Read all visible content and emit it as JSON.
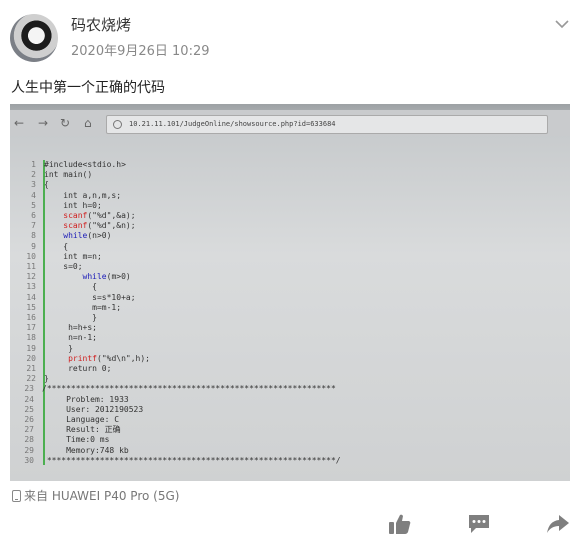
{
  "post": {
    "username": "码农烧烤",
    "timestamp": "2020年9月26日 10:29",
    "text": "人生中第一个正确的代码",
    "device": "来自 HUAWEI P40 Pro (5G)"
  },
  "photo": {
    "url": "10.21.11.101/JudgeOnline/showsource.php?id=633684",
    "code_lines": [
      {
        "n": "1",
        "text": "#include<stdio.h>"
      },
      {
        "n": "2",
        "text": "int main()"
      },
      {
        "n": "3",
        "text": "{"
      },
      {
        "n": "4",
        "text": "    int a,n,m,s;"
      },
      {
        "n": "5",
        "text": "    int h=0;"
      },
      {
        "n": "6",
        "text": "    scanf(\"%d\",&a);"
      },
      {
        "n": "7",
        "text": "    scanf(\"%d\",&n);"
      },
      {
        "n": "8",
        "text": "    while(n>0)"
      },
      {
        "n": "9",
        "text": "    {"
      },
      {
        "n": "10",
        "text": "    int m=n;"
      },
      {
        "n": "11",
        "text": "    s=0;"
      },
      {
        "n": "12",
        "text": "        while(m>0)"
      },
      {
        "n": "13",
        "text": "          {"
      },
      {
        "n": "14",
        "text": "          s=s*10+a;"
      },
      {
        "n": "15",
        "text": "          m=m-1;"
      },
      {
        "n": "16",
        "text": "          }"
      },
      {
        "n": "17",
        "text": "     h=h+s;"
      },
      {
        "n": "18",
        "text": "     n=n-1;"
      },
      {
        "n": "19",
        "text": "     }"
      },
      {
        "n": "20",
        "text": "     printf(\"%d\\n\",h);"
      },
      {
        "n": "21",
        "text": "     return 0;"
      },
      {
        "n": "22",
        "text": "}"
      },
      {
        "n": "23",
        "text": "/************************************************************"
      },
      {
        "n": "24",
        "text": "     Problem: 1933"
      },
      {
        "n": "25",
        "text": "     User: 2012190523"
      },
      {
        "n": "26",
        "text": "     Language: C"
      },
      {
        "n": "27",
        "text": "     Result: 正确"
      },
      {
        "n": "28",
        "text": "     Time:0 ms"
      },
      {
        "n": "29",
        "text": "     Memory:748 kb"
      },
      {
        "n": "30",
        "text": " ************************************************************/"
      }
    ]
  },
  "icons": {
    "chevron": "chevron-down-icon",
    "like": "thumbs-up-icon",
    "comment": "comment-icon",
    "share": "share-icon",
    "device": "phone-icon"
  },
  "colors": {
    "accent": "#888888",
    "gutter": "#4caf50",
    "keyword_red": "#d02020",
    "keyword_blue": "#1d1db8"
  }
}
